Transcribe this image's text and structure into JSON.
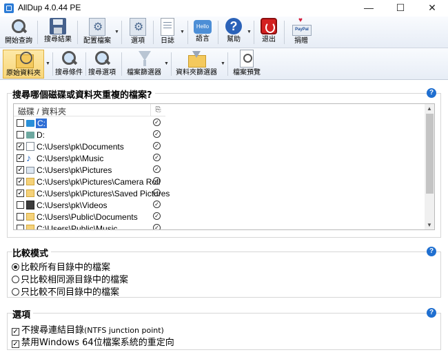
{
  "window": {
    "title": "AllDup 4.0.44 PE",
    "minimize": "—",
    "maximize": "☐",
    "close": "✕"
  },
  "toolbar1": {
    "items": [
      {
        "label": "開始查詢",
        "icon": "search-icon"
      },
      {
        "label": "搜尋結果",
        "icon": "floppy-icon"
      },
      {
        "label": "配置檔案",
        "icon": "gears-icon"
      },
      {
        "label": "選項",
        "icon": "options-icon"
      },
      {
        "label": "日誌",
        "icon": "log-icon"
      },
      {
        "label": "語言",
        "icon": "hello-icon",
        "icon_text": "Hello"
      },
      {
        "label": "幫助",
        "icon": "help-icon",
        "icon_text": "?"
      },
      {
        "label": "退出",
        "icon": "exit-icon"
      },
      {
        "label": "捐贈",
        "icon": "paypal-icon"
      }
    ]
  },
  "toolbar2": {
    "items": [
      {
        "label": "原始資料夾",
        "icon": "folder-search-icon"
      },
      {
        "label": "搜尋條件",
        "icon": "search-icon"
      },
      {
        "label": "搜尋選項",
        "icon": "search-icon"
      },
      {
        "label": "檔案篩選器",
        "icon": "filter-icon"
      },
      {
        "label": "資料夾篩選器",
        "icon": "folder-filter-icon"
      },
      {
        "label": "檔案預覽",
        "icon": "preview-icon"
      }
    ]
  },
  "source_group": {
    "title": "搜尋哪個磁碟或資料夾重複的檔案?",
    "header_col1": "磁碟 / 資料夾",
    "header_col2": "⎘",
    "rows": [
      {
        "checked": false,
        "icon": "drive",
        "path": "C:",
        "selected": true
      },
      {
        "checked": false,
        "icon": "drive2",
        "path": "D:",
        "selected": false
      },
      {
        "checked": true,
        "icon": "doc",
        "path": "C:\\Users\\pk\\Documents",
        "selected": false
      },
      {
        "checked": true,
        "icon": "music",
        "path": "C:\\Users\\pk\\Music",
        "selected": false
      },
      {
        "checked": true,
        "icon": "pic",
        "path": "C:\\Users\\pk\\Pictures",
        "selected": false
      },
      {
        "checked": true,
        "icon": "folder",
        "path": "C:\\Users\\pk\\Pictures\\Camera Roll",
        "selected": false
      },
      {
        "checked": true,
        "icon": "folder",
        "path": "C:\\Users\\pk\\Pictures\\Saved Pictures",
        "selected": false
      },
      {
        "checked": false,
        "icon": "video",
        "path": "C:\\Users\\pk\\Videos",
        "selected": false
      },
      {
        "checked": false,
        "icon": "folder",
        "path": "C:\\Users\\Public\\Documents",
        "selected": false
      },
      {
        "checked": false,
        "icon": "folder",
        "path": "C:\\Users\\Public\\Music",
        "selected": false
      }
    ]
  },
  "compare_group": {
    "title": "比較模式",
    "options": [
      {
        "label": "比較所有目錄中的檔案",
        "selected": true
      },
      {
        "label": "只比較相同源目錄中的檔案",
        "selected": false
      },
      {
        "label": "只比較不同目錄中的檔案",
        "selected": false
      }
    ]
  },
  "options_group": {
    "title": "選項",
    "options": [
      {
        "label": "不搜尋連結目錄",
        "suffix": "(NTFS junction point)",
        "checked": true
      },
      {
        "label": "禁用Windows 64位檔案系統的重定向",
        "suffix": "",
        "checked": true
      }
    ]
  },
  "help_symbol": "?",
  "check_mark": "✓"
}
